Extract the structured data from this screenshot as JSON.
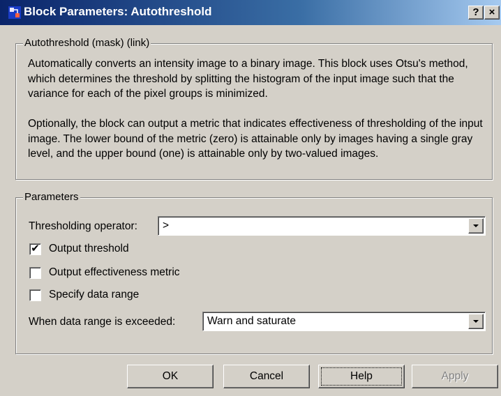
{
  "window": {
    "title": "Block Parameters: Autothreshold",
    "help_glyph": "?",
    "close_glyph": "×"
  },
  "description_group": {
    "legend": "Autothreshold (mask) (link)",
    "paragraph1": "Automatically converts an intensity image to a binary image.  This block uses Otsu's method, which determines the threshold by splitting the histogram of the input image such that the variance for each of the pixel groups is minimized.",
    "paragraph2": "Optionally, the block can output a metric that indicates effectiveness of thresholding of the input image.  The lower bound of the metric (zero) is attainable only by images having a single gray level, and the upper bound (one) is attainable only by two-valued images."
  },
  "parameters_group": {
    "legend": "Parameters",
    "thresholding_operator": {
      "label": "Thresholding operator:",
      "value": ">"
    },
    "output_threshold": {
      "label": "Output threshold",
      "checked": true,
      "mark": "✔"
    },
    "output_effectiveness": {
      "label": "Output effectiveness metric",
      "checked": false,
      "mark": ""
    },
    "specify_data_range": {
      "label": "Specify data range",
      "checked": false,
      "mark": ""
    },
    "data_range_exceeded": {
      "label": "When data range is exceeded:",
      "value": "Warn and saturate"
    }
  },
  "buttons": {
    "ok": "OK",
    "cancel": "Cancel",
    "help": "Help",
    "apply": "Apply"
  }
}
